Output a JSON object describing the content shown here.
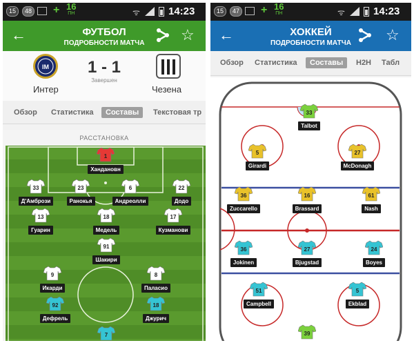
{
  "status_bar": {
    "notif_count": "15",
    "msg_count_left": "48",
    "msg_count_right": "47",
    "date_day": "16",
    "date_weekday": "ПН",
    "time": "14:23"
  },
  "football": {
    "header": {
      "title": "ФУТБОЛ",
      "subtitle": "ПОДРОБНОСТИ МАТЧА"
    },
    "match": {
      "home_team": "Интер",
      "away_team": "Чезена",
      "score": "1 - 1",
      "status": "Завершен"
    },
    "tabs": [
      "Обзор",
      "Статистика",
      "Составы",
      "Текстовая тр"
    ],
    "active_tab": "Составы",
    "section_title": "РАССТАНОВКА",
    "players": [
      {
        "number": "1",
        "name": "Хандановн",
        "kit": "red"
      },
      {
        "number": "33",
        "name": "Д'Амбрози",
        "kit": "white"
      },
      {
        "number": "23",
        "name": "Ранокья",
        "kit": "white"
      },
      {
        "number": "6",
        "name": "Андреолли",
        "kit": "white"
      },
      {
        "number": "22",
        "name": "Додо",
        "kit": "white"
      },
      {
        "number": "13",
        "name": "Гуарин",
        "kit": "white"
      },
      {
        "number": "18",
        "name": "Медель",
        "kit": "white"
      },
      {
        "number": "17",
        "name": "Кузманови",
        "kit": "white"
      },
      {
        "number": "91",
        "name": "Шакири",
        "kit": "white"
      },
      {
        "number": "9",
        "name": "Икарди",
        "kit": "white"
      },
      {
        "number": "8",
        "name": "Паласио",
        "kit": "white"
      },
      {
        "number": "92",
        "name": "Дефрель",
        "kit": "cyan"
      },
      {
        "number": "18",
        "name": "Джурич",
        "kit": "cyan"
      },
      {
        "number": "7",
        "name": "",
        "kit": "cyan"
      }
    ]
  },
  "hockey": {
    "header": {
      "title": "ХОККЕЙ",
      "subtitle": "ПОДРОБНОСТИ МАТЧА"
    },
    "tabs": [
      "Обзор",
      "Статистика",
      "Составы",
      "H2H",
      "Табл"
    ],
    "active_tab": "Составы",
    "players": [
      {
        "number": "33",
        "name": "Talbot",
        "kit": "green"
      },
      {
        "number": "5",
        "name": "Girardi",
        "kit": "yellow"
      },
      {
        "number": "27",
        "name": "McDonagh",
        "kit": "yellow"
      },
      {
        "number": "36",
        "name": "Zuccarello",
        "kit": "yellow"
      },
      {
        "number": "16",
        "name": "Brassard",
        "kit": "yellow"
      },
      {
        "number": "61",
        "name": "Nash",
        "kit": "yellow"
      },
      {
        "number": "36",
        "name": "Jokinen",
        "kit": "cyan"
      },
      {
        "number": "27",
        "name": "Bjugstad",
        "kit": "cyan"
      },
      {
        "number": "24",
        "name": "Boyes",
        "kit": "cyan"
      },
      {
        "number": "51",
        "name": "Campbell",
        "kit": "cyan"
      },
      {
        "number": "5",
        "name": "Ekblad",
        "kit": "cyan"
      },
      {
        "number": "39",
        "name": "",
        "kit": "green"
      }
    ]
  },
  "colors": {
    "football_header": "#3f9a2a",
    "hockey_header": "#1a6fb4",
    "pitch_green": "#5a9a2e",
    "kit_red": "#e53935",
    "kit_white": "#ffffff",
    "kit_cyan": "#35c4d3",
    "kit_yellow": "#e9c22a",
    "kit_green": "#7bd13c",
    "rink_red": "#c62828",
    "rink_blue": "#3b4fa0"
  },
  "icons": {
    "back": "arrow-left-icon",
    "share": "share-icon",
    "favorite": "star-outline-icon",
    "wifi": "wifi-icon",
    "signal": "signal-icon",
    "battery": "battery-icon",
    "home_crest": "inter-crest-icon",
    "away_crest": "cesena-crest-icon"
  }
}
